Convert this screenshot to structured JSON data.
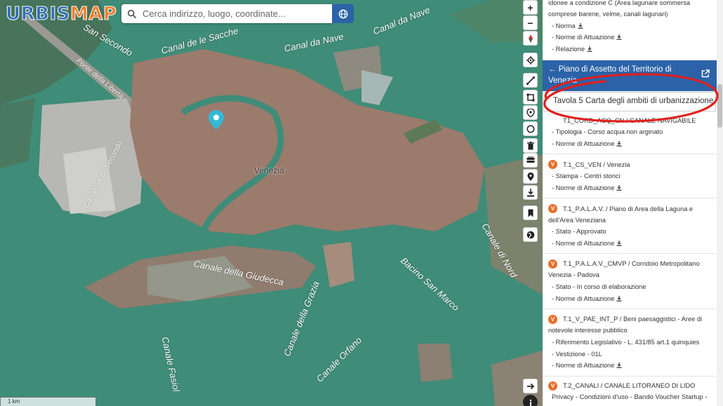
{
  "app": {
    "logo_part1": "URBIS",
    "logo_part2": "MAP"
  },
  "search": {
    "placeholder": "Cerca indirizzo, luogo, coordinate..."
  },
  "map": {
    "city_label": "Venezia",
    "scale_label": "1 km",
    "labels": [
      {
        "text": "San Secondo"
      },
      {
        "text": "Canal de le Sacche"
      },
      {
        "text": "Canal da Nave"
      },
      {
        "text": "Canal da Nave"
      },
      {
        "text": "Ponte della Libertà"
      },
      {
        "text": "Canale di S. Secondo"
      },
      {
        "text": "Canale della Giudecca"
      },
      {
        "text": "Bacino San Marco"
      },
      {
        "text": "Canale della Grazia"
      },
      {
        "text": "Canale Fasiol"
      },
      {
        "text": "Canale Orfano"
      },
      {
        "text": "Canale di Nord"
      }
    ]
  },
  "toolbar": {
    "zoom_in": "+",
    "zoom_out": "−"
  },
  "panel": {
    "top_lines": [
      "idonee a condizione C (Area lagunare sommersa",
      "comprese barene, velme, canali lagunari)"
    ],
    "top_links": [
      "- Norma",
      "- Norme di Attuazione",
      "- Relazione"
    ],
    "header_title": "← Piano di Assetto del Territorio di Venezia",
    "layer_selected": "Tavola 5 Carta degli ambiti di urbanizzazione",
    "entries": [
      {
        "badge": "",
        "title_lines": [
          "T1_CORD_ACQ_CN / CANALE NAVIGABILE"
        ],
        "subs": [
          "- Tipologia - Corso acqua non arginato",
          "- Norme di Attuazione"
        ]
      },
      {
        "badge": "V",
        "title_lines": [
          "T.1_CS_VEN / Venezia"
        ],
        "subs": [
          "- Stampa - Centri storici",
          "- Norme di Attuazione"
        ]
      },
      {
        "badge": "V",
        "title_lines": [
          "T.1_P.A.L.A.V. / Piano di Area della Laguna e",
          "dell'Area Veneziana"
        ],
        "subs": [
          "- Stato - Approvato",
          "- Norme di Attuazione"
        ]
      },
      {
        "badge": "V",
        "title_lines": [
          "T.1_P.A.L.A.V._CMVP / Corridoio Metropolitano",
          "Venezia - Padova"
        ],
        "subs": [
          "- Stato - In corso di elaborazione",
          "- Norme di Attuazione"
        ]
      },
      {
        "badge": "V",
        "title_lines": [
          "T.1_V_PAE_INT_P / Beni paesaggistici - Aree di",
          "notevole interesse pubblico"
        ],
        "subs": [
          "- Riferimento Legislativo - L. 431/85 art.1 quinquies",
          "- Vestizione - 01L",
          "- Norme di Attuazione"
        ]
      },
      {
        "badge": "V",
        "title_lines": [
          "T.2_CANALI / CANALE LITORANEO DI LIDO"
        ],
        "subs": []
      }
    ],
    "footer": "Privacy - Condizioni d'uso - Bando Voucher Startup -"
  },
  "colors": {
    "primary": "#2c63a8",
    "accent": "#e96f2b",
    "water": "#3f8c78",
    "annotation": "#e0201e"
  }
}
